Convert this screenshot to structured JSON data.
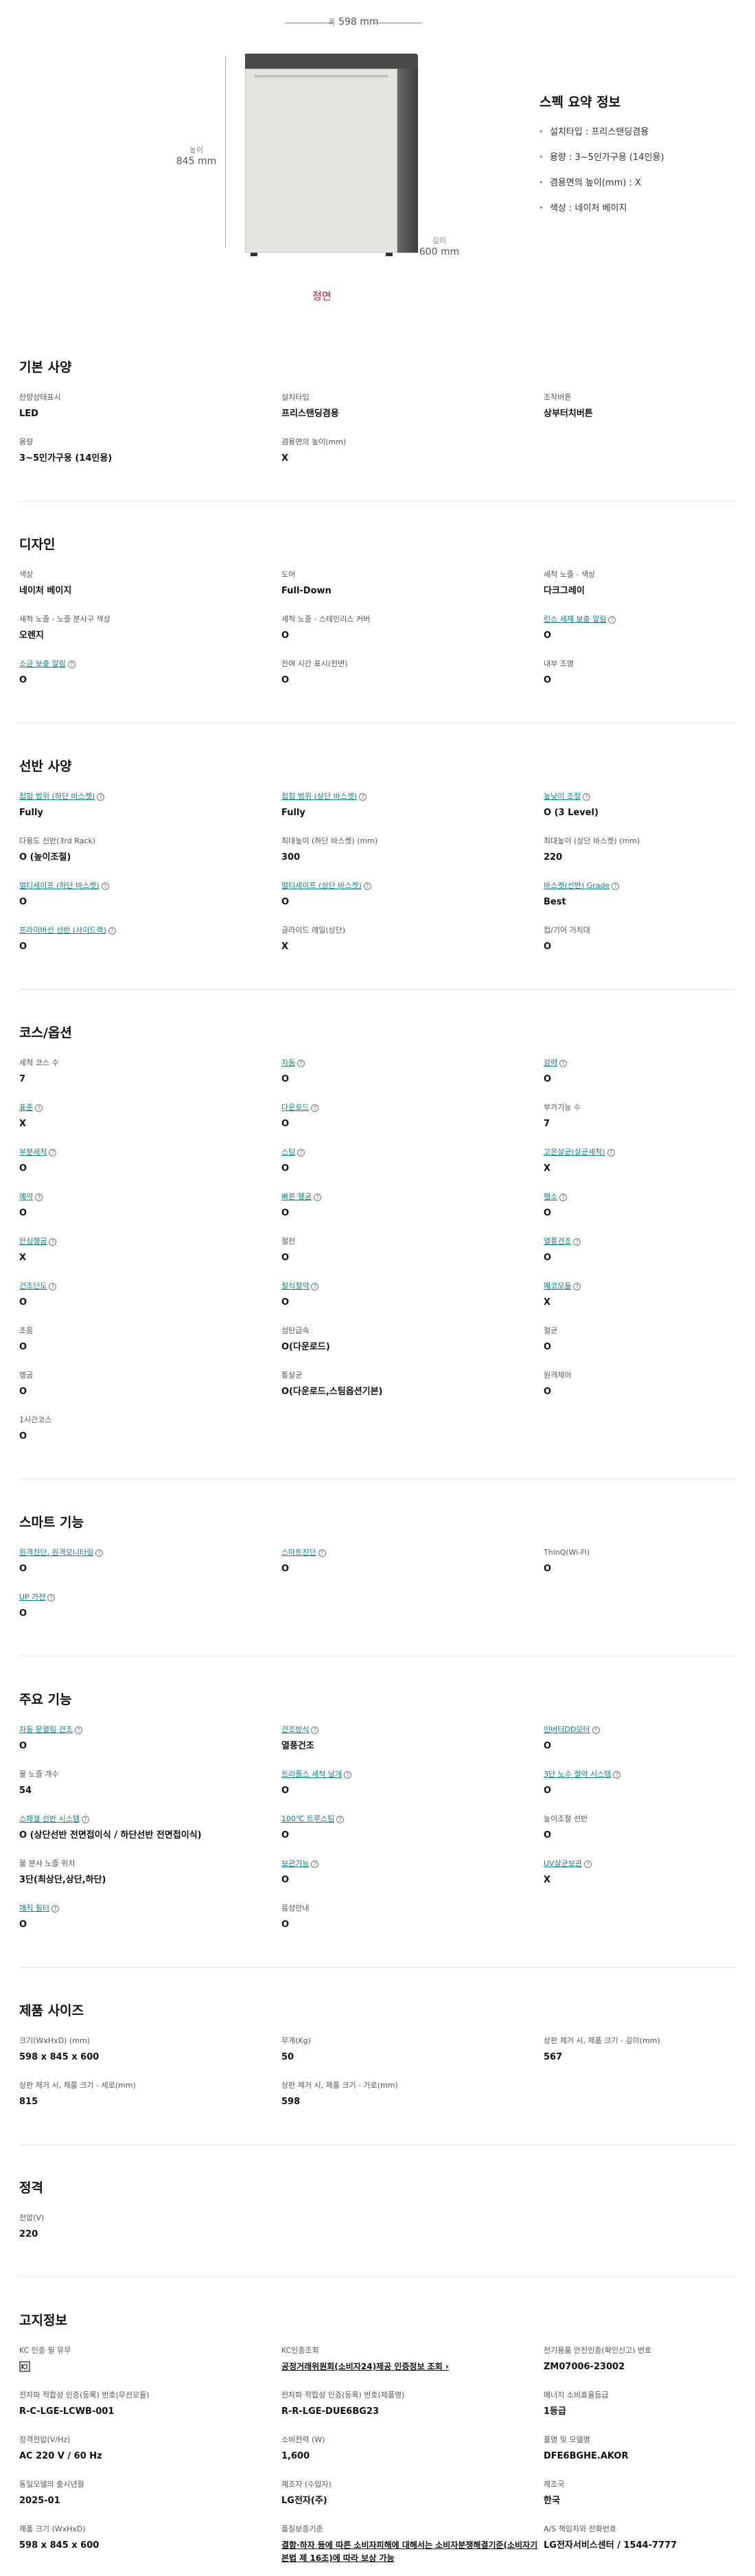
{
  "hero": {
    "width_label": "폭",
    "width_value": "598 mm",
    "height_label": "높이",
    "height_value": "845 mm",
    "depth_label": "깊이",
    "depth_value": "600 mm",
    "front_label": "정면"
  },
  "summary": {
    "title": "스펙 요약 정보",
    "items": [
      "설치타입 : 프리스탠딩겸용",
      "용량 : 3~5인가구용 (14인용)",
      "겸용면의 높이(mm) : X",
      "색상 : 네이처 베이지"
    ]
  },
  "sections": [
    {
      "title": "기본 사양",
      "items": [
        {
          "label": "잔량상태표시",
          "value": "LED",
          "link": false
        },
        {
          "label": "설치타입",
          "value": "프리스탠딩겸용",
          "link": false
        },
        {
          "label": "조작버튼",
          "value": "상부터치버튼",
          "link": false
        },
        {
          "label": "용량",
          "value": "3~5인가구용 (14인용)",
          "link": false
        },
        {
          "label": "겸용면의 높이(mm)",
          "value": "X",
          "link": false
        }
      ]
    },
    {
      "title": "디자인",
      "items": [
        {
          "label": "색상",
          "value": "네이처 베이지",
          "link": false
        },
        {
          "label": "도어",
          "value": "Full-Down",
          "link": false
        },
        {
          "label": "세척 노즐 - 색상",
          "value": "다크그레이",
          "link": false
        },
        {
          "label": "세척 노즐 - 노즐 분사구 색상",
          "value": "오렌지",
          "link": false
        },
        {
          "label": "세척 노즐 - 스테인리스 커버",
          "value": "O",
          "link": false
        },
        {
          "label": "린스 세제 보충 알림",
          "value": "O",
          "link": true
        },
        {
          "label": "소금 보충 알림",
          "value": "O",
          "link": true
        },
        {
          "label": "잔여 시간 표시(전면)",
          "value": "O",
          "link": false
        },
        {
          "label": "내부 조명",
          "value": "O",
          "link": false
        }
      ]
    },
    {
      "title": "선반 사양",
      "items": [
        {
          "label": "접힘 범위 (하단 바스켓)",
          "value": "Fully",
          "link": true
        },
        {
          "label": "접힘 범위 (상단 바스켓)",
          "value": "Fully",
          "link": true
        },
        {
          "label": "높낮이 조절",
          "value": "O (3 Level)",
          "link": true
        },
        {
          "label": "다용도 선반(3rd Rack)",
          "value": "O (높이조절)",
          "link": false
        },
        {
          "label": "최대높이 (하단 바스켓) (mm)",
          "value": "300",
          "link": false
        },
        {
          "label": "최대높이 (상단 바스켓) (mm)",
          "value": "220",
          "link": false
        },
        {
          "label": "멀티세이프 (하단 바스켓)",
          "value": "O",
          "link": true
        },
        {
          "label": "멀티세이프 (상단 바스켓)",
          "value": "O",
          "link": true
        },
        {
          "label": "바스켓(선반) Grade",
          "value": "Best",
          "link": true
        },
        {
          "label": "프라이버선 선반 (사이드랙)",
          "value": "O",
          "link": true
        },
        {
          "label": "글라이드 레일(상단)",
          "value": "X",
          "link": false
        },
        {
          "label": "컵/기어 거치대",
          "value": "O",
          "link": false
        }
      ]
    },
    {
      "title": "코스/옵션",
      "items": [
        {
          "label": "세척 코스 수",
          "value": "7",
          "link": false
        },
        {
          "label": "자동",
          "value": "O",
          "link": true
        },
        {
          "label": "강력",
          "value": "O",
          "link": true
        },
        {
          "label": "표준",
          "value": "X",
          "link": true
        },
        {
          "label": "다운로드",
          "value": "O",
          "link": true
        },
        {
          "label": "부가기능 수",
          "value": "7",
          "link": false
        },
        {
          "label": "부분세척",
          "value": "O",
          "link": true
        },
        {
          "label": "스팀",
          "value": "O",
          "link": true
        },
        {
          "label": "고온살균(살균세척)",
          "value": "X",
          "link": true
        },
        {
          "label": "예약",
          "value": "O",
          "link": true
        },
        {
          "label": "빠른 헹굼",
          "value": "O",
          "link": true
        },
        {
          "label": "헹소",
          "value": "O",
          "link": true
        },
        {
          "label": "안심헹굼",
          "value": "X",
          "link": true
        },
        {
          "label": "절전",
          "value": "O",
          "link": false
        },
        {
          "label": "열풍건조",
          "value": "O",
          "link": true
        },
        {
          "label": "건조단도",
          "value": "O",
          "link": true
        },
        {
          "label": "절식절약",
          "value": "O",
          "link": true
        },
        {
          "label": "에코모듈",
          "value": "X",
          "link": true
        },
        {
          "label": "초음",
          "value": "O",
          "link": false
        },
        {
          "label": "섬탄급속",
          "value": "O(다운로드)",
          "link": false
        },
        {
          "label": "절균",
          "value": "O",
          "link": false
        },
        {
          "label": "헹굼",
          "value": "O",
          "link": false
        },
        {
          "label": "통살균",
          "value": "O(다운로드,스팀옵션기본)",
          "link": false
        },
        {
          "label": "원격제어",
          "value": "O",
          "link": false
        },
        {
          "label": "1시간코스",
          "value": "O",
          "link": false
        }
      ]
    },
    {
      "title": "스마트 기능",
      "items": [
        {
          "label": "원격진단, 원격모니터링",
          "value": "O",
          "link": true
        },
        {
          "label": "스마트진단",
          "value": "O",
          "link": true
        },
        {
          "label": "ThinQ(Wi-Fi)",
          "value": "O",
          "link": false
        },
        {
          "label": "UP 가전",
          "value": "O",
          "link": true
        }
      ]
    },
    {
      "title": "주요 기능",
      "items": [
        {
          "label": "자동 문열림 건조",
          "value": "O",
          "link": true
        },
        {
          "label": "건조방식",
          "value": "열풍건조",
          "link": true
        },
        {
          "label": "인버터DD모터",
          "value": "O",
          "link": true
        },
        {
          "label": "물 노즐 개수",
          "value": "54",
          "link": false
        },
        {
          "label": "트리플스 세척 날개",
          "value": "O",
          "link": true
        },
        {
          "label": "3단 노수 절약 시스템",
          "value": "O",
          "link": true
        },
        {
          "label": "스페셜 선반 시스템",
          "value": "O (상단선반 전면접이식 / 하단선반 전면접이식)",
          "link": true
        },
        {
          "label": "100℃ 트루스팀",
          "value": "O",
          "link": true
        },
        {
          "label": "높이조절 선반",
          "value": "O",
          "link": false
        },
        {
          "label": "물 분사 노즐 위치",
          "value": "3단(최상단,상단,하단)",
          "link": false
        },
        {
          "label": "보관기능",
          "value": "O",
          "link": true
        },
        {
          "label": "UV살균보관",
          "value": "X",
          "link": true
        },
        {
          "label": "매직 필터",
          "value": "O",
          "link": true
        },
        {
          "label": "음성안내",
          "value": "O",
          "link": false
        }
      ]
    },
    {
      "title": "제품 사이즈",
      "items": [
        {
          "label": "크기(WxHxD) (mm)",
          "value": "598 x 845 x 600",
          "link": false
        },
        {
          "label": "무게(Kg)",
          "value": "50",
          "link": false
        },
        {
          "label": "상판 제거 시, 제품 크기 - 깊이(mm)",
          "value": "567",
          "link": false
        },
        {
          "label": "상판 제거 시, 제품 크기 - 세로(mm)",
          "value": "815",
          "link": false
        },
        {
          "label": "상판 제거 시, 제품 크기 - 가로(mm)",
          "value": "598",
          "link": false
        }
      ]
    },
    {
      "title": "정격",
      "items": [
        {
          "label": "전압(V)",
          "value": "220",
          "link": false
        }
      ]
    },
    {
      "title": "고지정보",
      "items": [
        {
          "label": "KC 인증 필 유무",
          "value": "",
          "link": false,
          "qr": true
        },
        {
          "label": "KC인증조회",
          "value": "공정거래위원회(소비자24)제공 인증정보 조회 ›",
          "link": false,
          "underline": true
        },
        {
          "label": "전기용품 안전인증(확인신고) 번호",
          "value": "ZM07006-23002",
          "link": false
        },
        {
          "label": "전자파 적합성 인증(등록) 번호(무선모듈)",
          "value": "R-C-LGE-LCWB-001",
          "link": false
        },
        {
          "label": "전자파 적합성 인증(등록) 번호(제품명)",
          "value": "R-R-LGE-DUE6BG23",
          "link": false
        },
        {
          "label": "에너지 소비효율등급",
          "value": "1등급",
          "link": false
        },
        {
          "label": "정격전압(V/Hz)",
          "value": "AC 220 V / 60 Hz",
          "link": false
        },
        {
          "label": "소비전력 (W)",
          "value": "1,600",
          "link": false
        },
        {
          "label": "품명 및 모델명",
          "value": "DFE6BGHE.AKOR",
          "link": false
        },
        {
          "label": "동일모델의 출시년월",
          "value": "2025-01",
          "link": false
        },
        {
          "label": "제조자 (수입자)",
          "value": "LG전자(주)",
          "link": false
        },
        {
          "label": "제조국",
          "value": "한국",
          "link": false
        },
        {
          "label": "제품 크기 (WxHxD)",
          "value": "598 x 845 x 600",
          "link": false
        },
        {
          "label": "품질보증기준",
          "value": "결함·하자 등에 따른 소비자피해에 대해서는 소비자분쟁해결기준(소비자기본법 제 16조)에 따라 보상 가능",
          "link": false,
          "underline": true
        },
        {
          "label": "A/S 책임자와 전화번호",
          "value": "LG전자서비스센터 / 1544-7777",
          "link": false
        }
      ]
    }
  ]
}
